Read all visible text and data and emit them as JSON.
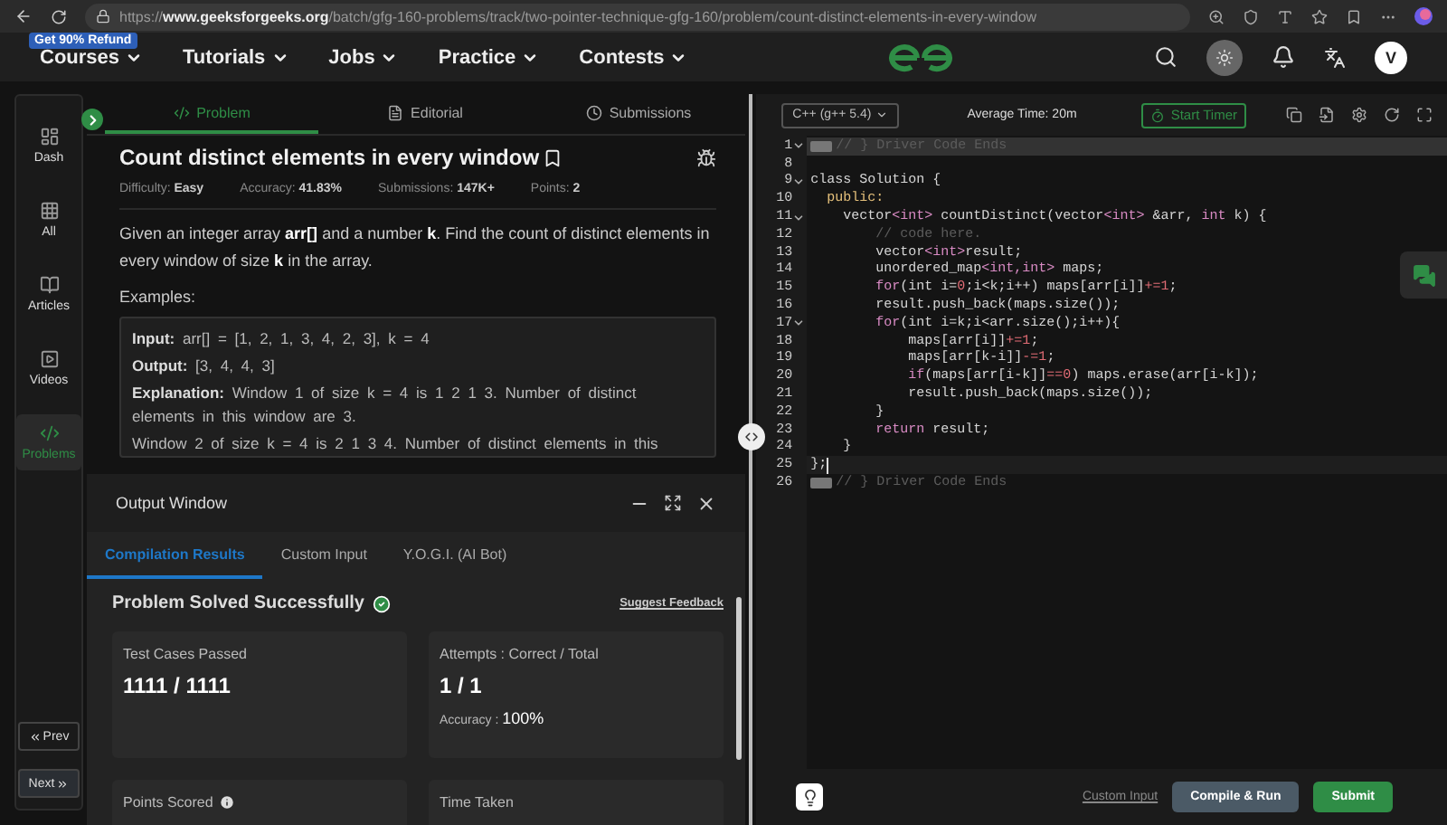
{
  "browser": {
    "url": "https://**www.geeksforgeeks.org**/batch/gfg-160-problems/track/two-pointer-technique-gfg-160/problem/count-distinct-elements-in-every-window"
  },
  "site_nav": {
    "badge": "Get 90% Refund",
    "items": [
      "Courses",
      "Tutorials",
      "Jobs",
      "Practice",
      "Contests"
    ],
    "avatar": "V"
  },
  "sidebar": {
    "items": [
      {
        "label": "Dash",
        "selected": false
      },
      {
        "label": "All",
        "selected": false
      },
      {
        "label": "Articles",
        "selected": false
      },
      {
        "label": "Videos",
        "selected": false
      },
      {
        "label": "Problems",
        "selected": true
      }
    ],
    "prev": "Prev",
    "next": "Next"
  },
  "problem": {
    "tabs": [
      {
        "label": "Problem",
        "selected": true
      },
      {
        "label": "Editorial",
        "selected": false
      },
      {
        "label": "Submissions",
        "selected": false
      }
    ],
    "title": "Count distinct elements in every window",
    "meta": [
      {
        "label": "Difficulty: ",
        "value": "Easy"
      },
      {
        "label": "Accuracy: ",
        "value": "41.83%"
      },
      {
        "label": "Submissions: ",
        "value": "147K+"
      },
      {
        "label": "Points: ",
        "value": "2"
      }
    ],
    "description": "Given an integer array **arr[]** and a number **k**. Find the count of distinct elements in every window of size **k** in the array.",
    "examples_heading": "Examples:",
    "example": [
      "**Input:** arr[] = [1, 2, 1, 3, 4, 2, 3], k = 4",
      "**Output:**  [3, 4, 4, 3]",
      "**Explanation:** Window 1 of size k = 4 is 1 2 1 3. Number of distinct elements in this window are 3.",
      "Window 2 of size k = 4 is 2 1 3 4. Number of distinct elements in this"
    ]
  },
  "output_window": {
    "title": "Output Window",
    "tabs": [
      {
        "label": "Compilation Results",
        "selected": true
      },
      {
        "label": "Custom Input",
        "selected": false
      },
      {
        "label": "Y.O.G.I. (AI Bot)",
        "selected": false
      }
    ],
    "status": "Problem Solved Successfully",
    "feedback": "Suggest Feedback",
    "cards": [
      {
        "label": "Test Cases Passed",
        "value": "1111 / 1111"
      },
      {
        "label": "Attempts : Correct / Total",
        "value": "1 / 1",
        "note_label": "Accuracy : ",
        "note_value": "100%"
      },
      {
        "label": "Points Scored",
        "info": true
      },
      {
        "label": "Time Taken",
        "info": false
      }
    ]
  },
  "editor": {
    "language": "C++ (g++ 5.4)",
    "average_time": "Average Time: 20m",
    "timer": "Start Timer",
    "lines": [
      {
        "number": "1",
        "foldable": true,
        "folded": true,
        "highlighted": true,
        "cursor": false,
        "tokens": [
          {
            "text": "// } Driver Code Ends",
            "kind": "comment"
          }
        ]
      },
      {
        "number": "8",
        "foldable": false,
        "folded": false,
        "highlighted": false,
        "cursor": false
      },
      {
        "number": "9",
        "foldable": true,
        "folded": false,
        "highlighted": false,
        "cursor": false,
        "tokens": [
          {
            "text": "class Solution {",
            "kind": "plain"
          }
        ]
      },
      {
        "number": "10",
        "foldable": false,
        "folded": false,
        "highlighted": false,
        "cursor": false,
        "tokens": [
          {
            "text": "  public:",
            "kind": "access"
          }
        ]
      },
      {
        "number": "11",
        "foldable": true,
        "folded": false,
        "highlighted": false,
        "cursor": false,
        "tokens": [
          {
            "text": "    vector",
            "kind": "plain"
          },
          {
            "text": "<int>",
            "kind": "keyword"
          },
          {
            "text": " countDistinct(vector",
            "kind": "plain"
          },
          {
            "text": "<int>",
            "kind": "keyword"
          },
          {
            "text": " &arr, ",
            "kind": "plain"
          },
          {
            "text": "int",
            "kind": "keyword"
          },
          {
            "text": " k) {",
            "kind": "plain"
          }
        ]
      },
      {
        "number": "12",
        "foldable": false,
        "folded": false,
        "highlighted": false,
        "cursor": false,
        "tokens": [
          {
            "text": "        // code here.",
            "kind": "comment"
          }
        ]
      },
      {
        "number": "13",
        "foldable": false,
        "folded": false,
        "highlighted": false,
        "cursor": false,
        "tokens": [
          {
            "text": "        vector",
            "kind": "plain"
          },
          {
            "text": "<int>",
            "kind": "keyword"
          },
          {
            "text": "result;",
            "kind": "plain"
          }
        ]
      },
      {
        "number": "14",
        "foldable": false,
        "folded": false,
        "highlighted": false,
        "cursor": false,
        "tokens": [
          {
            "text": "        unordered_map",
            "kind": "plain"
          },
          {
            "text": "<int,int>",
            "kind": "keyword"
          },
          {
            "text": " maps;",
            "kind": "plain"
          }
        ]
      },
      {
        "number": "15",
        "foldable": false,
        "folded": false,
        "highlighted": false,
        "cursor": false,
        "tokens": [
          {
            "text": "        for",
            "kind": "keyword"
          },
          {
            "text": "(int i=",
            "kind": "plain"
          },
          {
            "text": "0",
            "kind": "number"
          },
          {
            "text": ";i<k;i++) maps[arr[i]]",
            "kind": "plain"
          },
          {
            "text": "+=1",
            "kind": "number"
          },
          {
            "text": ";",
            "kind": "plain"
          }
        ]
      },
      {
        "number": "16",
        "foldable": false,
        "folded": false,
        "highlighted": false,
        "cursor": false,
        "tokens": [
          {
            "text": "        result.push_back(maps.size());",
            "kind": "plain"
          }
        ]
      },
      {
        "number": "17",
        "foldable": true,
        "folded": false,
        "highlighted": false,
        "cursor": false,
        "tokens": [
          {
            "text": "        for",
            "kind": "keyword"
          },
          {
            "text": "(int i=k;i<arr.size();i++){",
            "kind": "plain"
          }
        ]
      },
      {
        "number": "18",
        "foldable": false,
        "folded": false,
        "highlighted": false,
        "cursor": false,
        "tokens": [
          {
            "text": "            maps[arr[i]]",
            "kind": "plain"
          },
          {
            "text": "+=1",
            "kind": "number"
          },
          {
            "text": ";",
            "kind": "plain"
          }
        ]
      },
      {
        "number": "19",
        "foldable": false,
        "folded": false,
        "highlighted": false,
        "cursor": false,
        "tokens": [
          {
            "text": "            maps[arr[k-i]]",
            "kind": "plain"
          },
          {
            "text": "-=1",
            "kind": "number"
          },
          {
            "text": ";",
            "kind": "plain"
          }
        ]
      },
      {
        "number": "20",
        "foldable": false,
        "folded": false,
        "highlighted": false,
        "cursor": false,
        "tokens": [
          {
            "text": "            if",
            "kind": "keyword"
          },
          {
            "text": "(maps[arr[i-k]]",
            "kind": "plain"
          },
          {
            "text": "==0",
            "kind": "number"
          },
          {
            "text": ") maps.erase(arr[i-k]);",
            "kind": "plain"
          }
        ]
      },
      {
        "number": "21",
        "foldable": false,
        "folded": false,
        "highlighted": false,
        "cursor": false,
        "tokens": [
          {
            "text": "            result.push_back(maps.size());",
            "kind": "plain"
          }
        ]
      },
      {
        "number": "22",
        "foldable": false,
        "folded": false,
        "highlighted": false,
        "cursor": false,
        "tokens": [
          {
            "text": "        }",
            "kind": "plain"
          }
        ]
      },
      {
        "number": "23",
        "foldable": false,
        "folded": false,
        "highlighted": false,
        "cursor": false,
        "tokens": [
          {
            "text": "        return",
            "kind": "keyword"
          },
          {
            "text": " result;",
            "kind": "plain"
          }
        ]
      },
      {
        "number": "24",
        "foldable": false,
        "folded": false,
        "highlighted": false,
        "cursor": false,
        "tokens": [
          {
            "text": "    }",
            "kind": "plain"
          }
        ]
      },
      {
        "number": "25",
        "foldable": false,
        "folded": false,
        "highlighted": false,
        "cursor": true,
        "tokens": [
          {
            "text": "};",
            "kind": "plain"
          }
        ]
      },
      {
        "number": "26",
        "foldable": false,
        "folded": true,
        "highlighted": false,
        "cursor": false,
        "tokens": [
          {
            "text": "// } Driver Code Ends",
            "kind": "comment"
          }
        ]
      }
    ],
    "custom_input": "Custom Input",
    "compile": "Compile & Run",
    "submit": "Submit"
  }
}
